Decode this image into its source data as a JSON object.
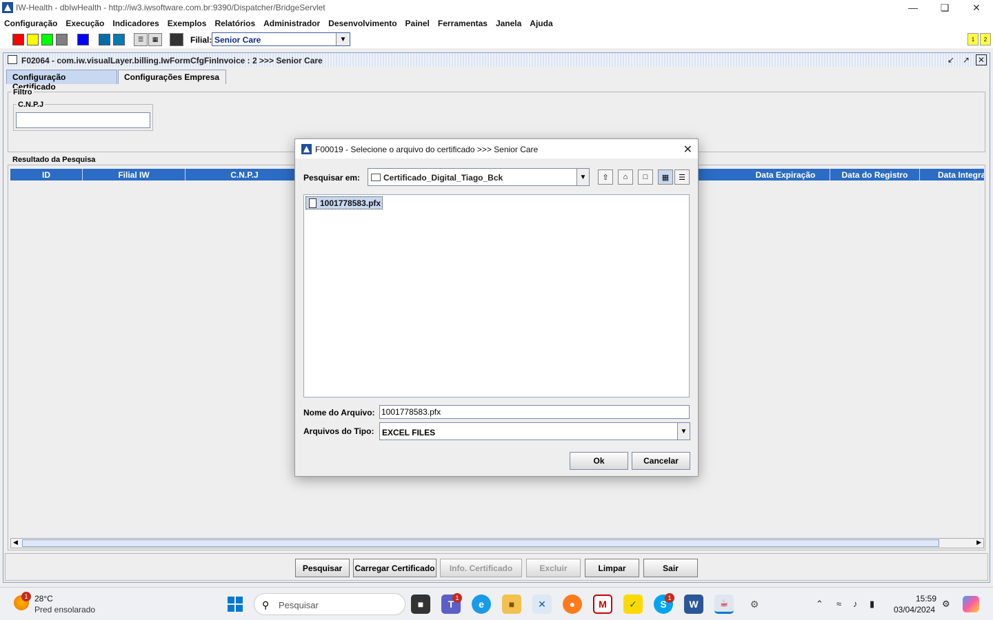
{
  "window": {
    "title": "IW-Health - dbIwHealth - http://iw3.iwsoftware.com.br:9390/Dispatcher/BridgeServlet"
  },
  "menu": [
    "Configuração",
    "Execução",
    "Indicadores",
    "Exemplos",
    "Relatórios",
    "Administrador",
    "Desenvolvimento",
    "Painel",
    "Ferramentas",
    "Janela",
    "Ajuda"
  ],
  "toolbar": {
    "swatch_colors": [
      "#ff0000",
      "#ffff00",
      "#00ff00",
      "#808080",
      "#0000ff",
      "#006da8",
      "#0a7ab0"
    ],
    "filial_label": "Filial:",
    "filial_value": "Senior Care",
    "right_buttons": [
      "1",
      "2"
    ]
  },
  "frame": {
    "title": "F02064 - com.iw.visualLayer.billing.IwFormCfgFinInvoice : 2 >>> Senior Care",
    "tabs": [
      "Configuração Certificado",
      "Configurações Empresa"
    ],
    "filtro_label": "Filtro",
    "cnpj_label": "C.N.P.J",
    "resultado_label": "Resultado da Pesquisa",
    "columns": [
      "ID",
      "Filial IW",
      "C.N.P.J",
      "Data Expiração",
      "Data do Registro",
      "Data Integra"
    ],
    "buttons": {
      "pesquisar": "Pesquisar",
      "carregar": "Carregar Certificado",
      "info": "Info. Certificado",
      "excluir": "Excluir",
      "limpar": "Limpar",
      "sair": "Sair"
    }
  },
  "dialog": {
    "title": "F00019 - Selecione o arquivo do certificado >>> Senior Care",
    "lookin_label": "Pesquisar em:",
    "lookin_value": "Certificado_Digital_Tiago_Bck",
    "files": [
      "1001778583.pfx"
    ],
    "filename_label": "Nome do Arquivo:",
    "filename_value": "1001778583.pfx",
    "filetype_label": "Arquivos do Tipo:",
    "filetype_value": "EXCEL FILES",
    "ok": "Ok",
    "cancel": "Cancelar"
  },
  "taskbar": {
    "weather_temp": "28°C",
    "weather_desc": "Pred ensolarado",
    "weather_badge": "1",
    "search_placeholder": "Pesquisar",
    "teams_badge": "1",
    "skype_badge": "1",
    "time": "15:59",
    "date": "03/04/2024"
  }
}
